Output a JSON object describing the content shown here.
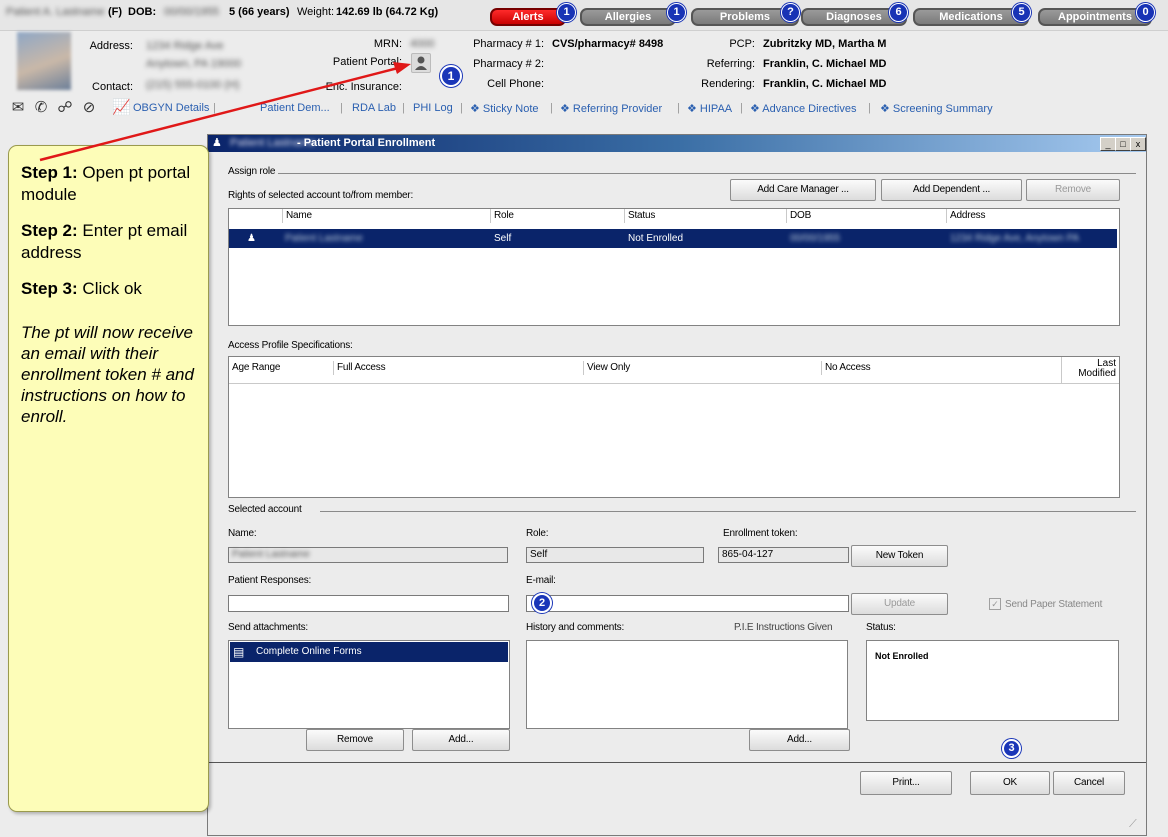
{
  "header": {
    "sex": "(F)",
    "dob_label": "DOB:",
    "age": "5 (66 years)",
    "weight_label": "Weight:",
    "weight_value": "142.69 lb (64.72 Kg)",
    "pills": [
      {
        "label": "Alerts",
        "count": "1",
        "color": "#e00000"
      },
      {
        "label": "Allergies",
        "count": "1",
        "color": "#8a8a8a"
      },
      {
        "label": "Problems",
        "count": "?",
        "color": "#8a8a8a"
      },
      {
        "label": "Diagnoses",
        "count": "6",
        "color": "#8a8a8a"
      },
      {
        "label": "Medications",
        "count": "5",
        "color": "#8a8a8a"
      },
      {
        "label": "Appointments",
        "count": "0",
        "color": "#8a8a8a"
      }
    ],
    "address_label": "Address:",
    "contact_label": "Contact:",
    "mrn_label": "MRN:",
    "portal_label": "Patient Portal:",
    "insurance_label": "Enc. Insurance:",
    "pharmacy1_label": "Pharmacy # 1:",
    "pharmacy1_value": "CVS/pharmacy# 8498",
    "pharmacy2_label": "Pharmacy # 2:",
    "cell_label": "Cell Phone:",
    "pcp_label": "PCP:",
    "pcp_value": "Zubritzky MD, Martha M",
    "referring_label": "Referring:",
    "referring_value": "Franklin, C. Michael MD",
    "rendering_label": "Rendering:",
    "rendering_value": "Franklin, C. Michael MD",
    "links": [
      "OBGYN Details",
      "Patient Dem...",
      "RDA Lab",
      "PHI Log",
      "❖ Sticky Note",
      "❖ Referring Provider",
      "❖ HIPAA",
      "❖ Advance Directives",
      "❖ Screening Summary"
    ]
  },
  "dialog": {
    "title": "- Patient Portal Enrollment",
    "assign_role": "Assign role",
    "rights_label": "Rights of selected account to/from member:",
    "add_care_manager": "Add Care Manager ...",
    "add_dependent": "Add Dependent ...",
    "remove_top": "Remove",
    "members_columns": [
      "Name",
      "Role",
      "Status",
      "DOB",
      "Address"
    ],
    "member_row": {
      "role": "Self",
      "status": "Not Enrolled"
    },
    "access_label": "Access Profile Specifications:",
    "access_columns": [
      "Age Range",
      "Full Access",
      "View Only",
      "No Access"
    ],
    "last_modified": "Last Modified",
    "selected_account": "Selected account",
    "name_label": "Name:",
    "role_label": "Role:",
    "role_value": "Self",
    "token_label": "Enrollment token:",
    "token_value": "865-04-127",
    "new_token": "New Token",
    "responses_label": "Patient Responses:",
    "email_label": "E-mail:",
    "update": "Update",
    "send_paper": "Send Paper Statement",
    "attachments_label": "Send attachments:",
    "attachment_item": "Complete Online Forms",
    "history_label": "History and comments:",
    "pie_label": "P.I.E Instructions Given",
    "status_label": "Status:",
    "status_value": "Not Enrolled",
    "remove_attach": "Remove",
    "add_attach": "Add...",
    "add_history": "Add...",
    "print": "Print...",
    "ok": "OK",
    "cancel": "Cancel",
    "win_buttons": [
      "_",
      "□",
      "x"
    ]
  },
  "callout": {
    "step1_bold": "Step 1:",
    "step1_text": "Open pt portal module",
    "step2_bold": "Step 2:",
    "step2_text": "Enter pt email address",
    "step3_bold": "Step 3:",
    "step3_text": "Click ok",
    "note": "The pt will now receive an email with their enrollment token # and instructions on how to enroll."
  },
  "markers": [
    "1",
    "2",
    "3"
  ]
}
